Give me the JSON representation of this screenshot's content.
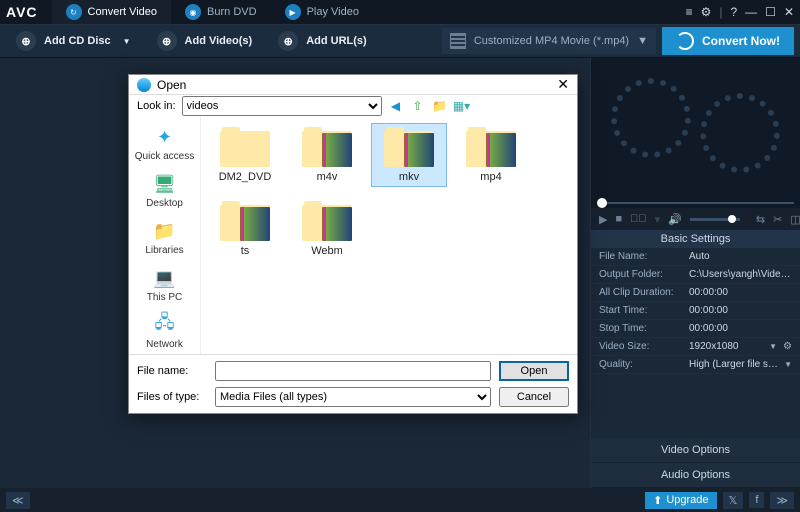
{
  "app": {
    "logo": "AVC"
  },
  "tabs": [
    {
      "label": "Convert Video",
      "icon": "refresh-icon",
      "active": true
    },
    {
      "label": "Burn DVD",
      "icon": "disc-icon",
      "active": false
    },
    {
      "label": "Play Video",
      "icon": "play-icon",
      "active": false
    }
  ],
  "window_controls": {
    "list": "≡",
    "settings": "⚙",
    "help": "?",
    "min": "—",
    "max": "☐",
    "close": "✕"
  },
  "toolbar": {
    "add_cd": "Add CD Disc",
    "add_videos": "Add Video(s)",
    "add_urls": "Add URL(s)",
    "profile": "Customized MP4 Movie (*.mp4)",
    "convert": "Convert Now!"
  },
  "settings": {
    "header": "Basic Settings",
    "rows": [
      {
        "k": "File Name:",
        "v": "Auto"
      },
      {
        "k": "Output Folder:",
        "v": "C:\\Users\\yangh\\Videos..."
      },
      {
        "k": "All Clip Duration:",
        "v": "00:00:00"
      },
      {
        "k": "Start Time:",
        "v": "00:00:00"
      },
      {
        "k": "Stop Time:",
        "v": "00:00:00"
      },
      {
        "k": "Video Size:",
        "v": "1920x1080",
        "dropdown": true,
        "gear": true
      },
      {
        "k": "Quality:",
        "v": "High (Larger file size)",
        "dropdown": true
      }
    ],
    "video_options": "Video Options",
    "audio_options": "Audio Options"
  },
  "bottom": {
    "upgrade": "Upgrade"
  },
  "dialog": {
    "title": "Open",
    "lookin_label": "Look in:",
    "lookin_value": "videos",
    "nav": [
      {
        "label": "Quick access",
        "glyph": "✦",
        "color": "#2aa3e0"
      },
      {
        "label": "Desktop",
        "glyph": "🖥",
        "color": "#3a7"
      },
      {
        "label": "Libraries",
        "glyph": "📁",
        "color": "#f5c23e"
      },
      {
        "label": "This PC",
        "glyph": "💻",
        "color": "#2aa3e0"
      },
      {
        "label": "Network",
        "glyph": "🖧",
        "color": "#2aa3e0"
      }
    ],
    "items": [
      {
        "label": "DM2_DVD",
        "empty": true
      },
      {
        "label": "m4v"
      },
      {
        "label": "mkv",
        "selected": true
      },
      {
        "label": "mp4"
      },
      {
        "label": "ts"
      },
      {
        "label": "Webm"
      }
    ],
    "filename_label": "File name:",
    "filename_value": "",
    "filetype_label": "Files of type:",
    "filetype_value": "Media Files (all types)",
    "open_btn": "Open",
    "cancel_btn": "Cancel"
  }
}
